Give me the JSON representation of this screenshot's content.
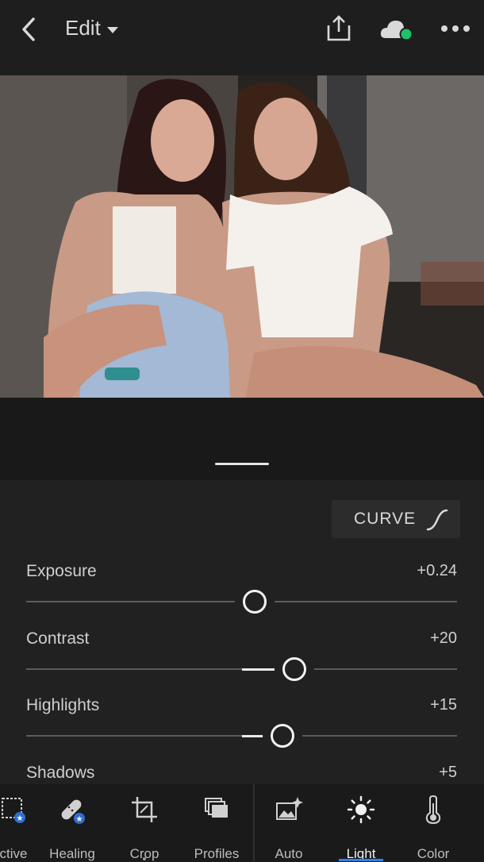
{
  "header": {
    "mode_label": "Edit"
  },
  "panel": {
    "curve_label": "CURVE",
    "sliders": [
      {
        "name": "Exposure",
        "value": "+0.24",
        "position": 0.53
      },
      {
        "name": "Contrast",
        "value": "+20",
        "position": 0.62
      },
      {
        "name": "Highlights",
        "value": "+15",
        "position": 0.59
      },
      {
        "name": "Shadows",
        "value": "+5",
        "position": 0.52
      }
    ]
  },
  "toolbar": {
    "tools": [
      {
        "label": "ctive",
        "icon": "selective-icon"
      },
      {
        "label": "Healing",
        "icon": "healing-bandage-icon"
      },
      {
        "label": "Crop",
        "icon": "crop-icon"
      },
      {
        "label": "Profiles",
        "icon": "profiles-icon"
      },
      {
        "label": "Auto",
        "icon": "auto-icon"
      },
      {
        "label": "Light",
        "icon": "light-sun-icon",
        "active": true
      },
      {
        "label": "Color",
        "icon": "color-thermometer-icon"
      }
    ]
  },
  "colors": {
    "accent": "#2f80ed",
    "sync_status": "#1fc16b"
  }
}
